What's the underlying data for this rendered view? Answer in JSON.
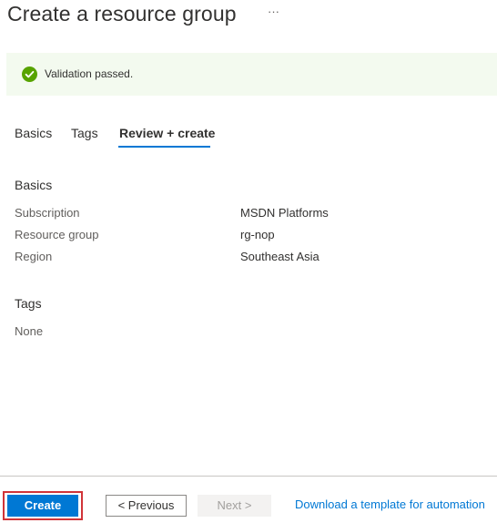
{
  "header": {
    "title": "Create a resource group",
    "more_label": "···"
  },
  "banner": {
    "icon": "check-circle-icon",
    "text": "Validation passed.",
    "color": "#57a300"
  },
  "tabs": [
    {
      "label": "Basics",
      "active": false
    },
    {
      "label": "Tags",
      "active": false
    },
    {
      "label": "Review + create",
      "active": true
    }
  ],
  "basics": {
    "title": "Basics",
    "rows": [
      {
        "label": "Subscription",
        "value": "MSDN Platforms"
      },
      {
        "label": "Resource group",
        "value": "rg-nop"
      },
      {
        "label": "Region",
        "value": "Southeast Asia"
      }
    ]
  },
  "tags": {
    "title": "Tags",
    "value": "None"
  },
  "footer": {
    "create_label": "Create",
    "previous_label": "< Previous",
    "next_label": "Next >",
    "download_link": "Download a template for automation"
  },
  "colors": {
    "accent": "#0078d4",
    "highlight": "#d13438"
  }
}
